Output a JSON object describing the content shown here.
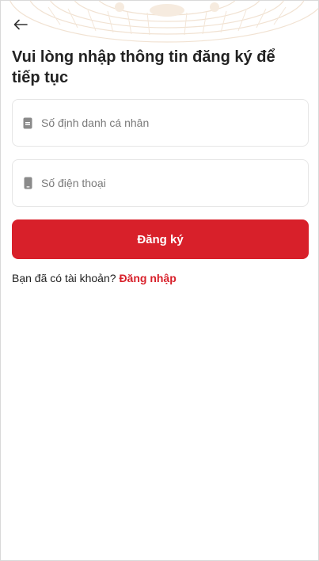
{
  "header": {
    "back_icon": "arrow-left-icon"
  },
  "title": "Vui lòng nhập thông tin đăng ký để tiếp tục",
  "form": {
    "id_field": {
      "icon": "id-card-icon",
      "value": "",
      "placeholder": "Số định danh cá nhân"
    },
    "phone_field": {
      "icon": "phone-icon",
      "value": "",
      "placeholder": "Số điện thoại"
    },
    "submit_label": "Đăng ký"
  },
  "footer": {
    "prompt": "Bạn đã có tài khoản?",
    "login_label": "Đăng nhập"
  },
  "colors": {
    "accent": "#d8202a",
    "text": "#222222",
    "placeholder": "#7a7a7a",
    "border": "#e6e6e6",
    "decor": "#f3e2cf"
  }
}
